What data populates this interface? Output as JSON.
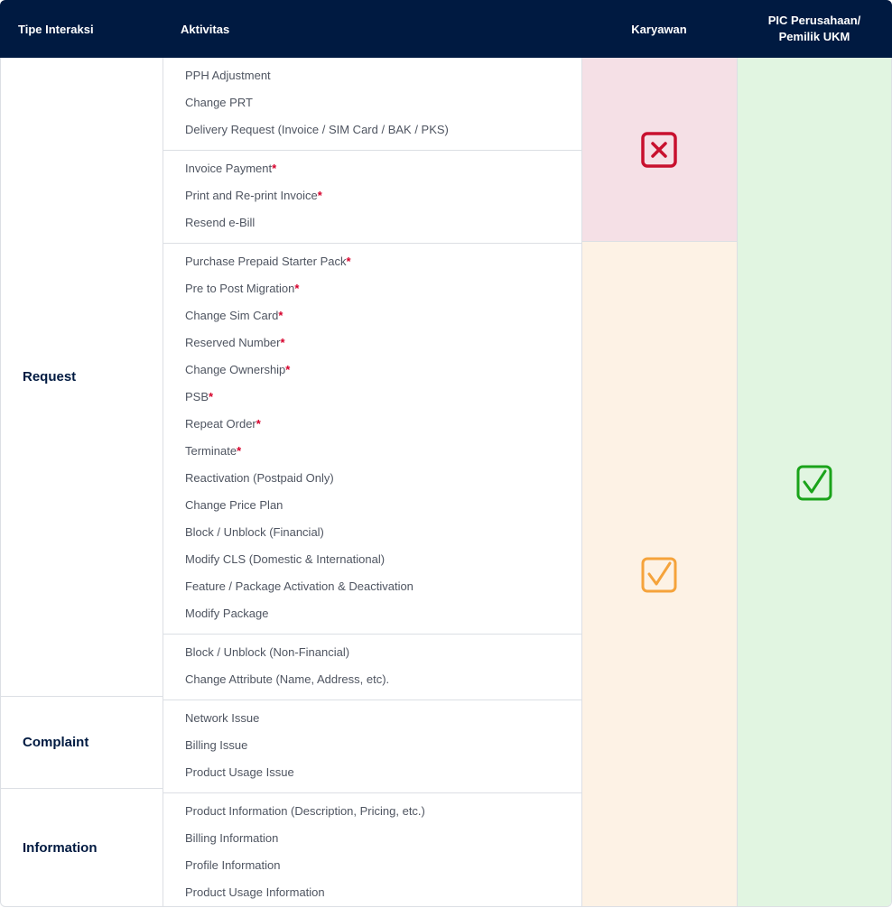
{
  "header": {
    "tipe": "Tipe Interaksi",
    "aktivitas": "Aktivitas",
    "karyawan": "Karyawan",
    "pic": "PIC Perusahaan/\nPemilik UKM"
  },
  "types": {
    "request": "Request",
    "complaint": "Complaint",
    "information": "Information"
  },
  "groups": [
    {
      "items": [
        {
          "text": "PPH Adjustment",
          "star": ""
        },
        {
          "text": "Change PRT",
          "star": ""
        },
        {
          "text": "Delivery Request (Invoice / SIM Card / BAK / PKS)",
          "star": ""
        }
      ]
    },
    {
      "items": [
        {
          "text": "Invoice Payment",
          "star": "*"
        },
        {
          "text": "Print and Re-print Invoice",
          "star": "*"
        },
        {
          "text": "Resend e-Bill",
          "star": ""
        }
      ]
    },
    {
      "items": [
        {
          "text": "Purchase Prepaid Starter Pack",
          "star": "*"
        },
        {
          "text": "Pre to Post Migration",
          "star": "*"
        },
        {
          "text": "Change Sim Card",
          "star": "*"
        },
        {
          "text": "Reserved Number",
          "star": "*"
        },
        {
          "text": "Change Ownership",
          "star": "*"
        },
        {
          "text": "PSB",
          "star": "*"
        },
        {
          "text": "Repeat Order",
          "star": "*"
        },
        {
          "text": "Terminate",
          "star": "*"
        },
        {
          "text": "Reactivation (Postpaid Only)",
          "star": ""
        },
        {
          "text": "Change Price Plan",
          "star": ""
        },
        {
          "text": "Block / Unblock (Financial)",
          "star": ""
        },
        {
          "text": "Modify CLS (Domestic & International)",
          "star": ""
        },
        {
          "text": "Feature / Package Activation & Deactivation",
          "star": ""
        },
        {
          "text": "Modify Package",
          "star": ""
        }
      ]
    },
    {
      "items": [
        {
          "text": "Block / Unblock (Non-Financial)",
          "star": ""
        },
        {
          "text": "Change Attribute (Name, Address, etc).",
          "star": ""
        }
      ]
    },
    {
      "items": [
        {
          "text": "Network Issue",
          "star": ""
        },
        {
          "text": "Billing Issue",
          "star": ""
        },
        {
          "text": "Product Usage Issue",
          "star": ""
        }
      ]
    },
    {
      "items": [
        {
          "text": "Product Information (Description, Pricing, etc.)",
          "star": ""
        },
        {
          "text": "Billing Information",
          "star": ""
        },
        {
          "text": "Profile Information",
          "star": ""
        },
        {
          "text": "Product Usage Information",
          "star": ""
        }
      ]
    }
  ],
  "colors": {
    "header_bg": "#001a41",
    "not_allowed": "#c8102e",
    "allowed_conditional": "#f5a33b",
    "allowed": "#1aa31a"
  },
  "icons": {
    "karyawan_top": "x-box-icon",
    "karyawan_bottom": "check-box-icon",
    "pic": "check-box-icon"
  }
}
